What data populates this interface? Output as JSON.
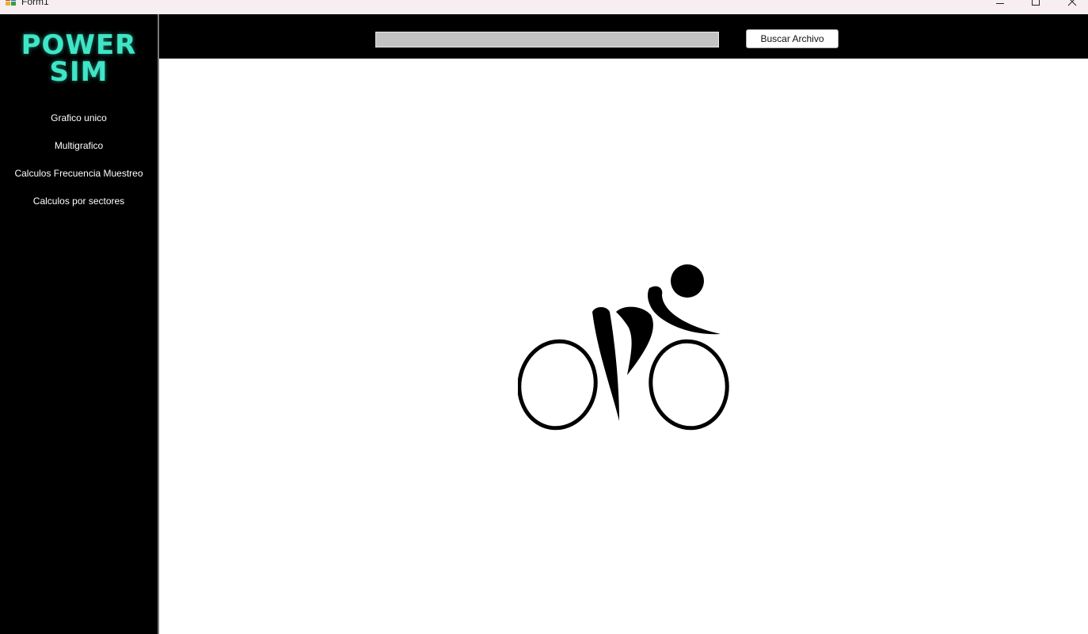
{
  "window": {
    "title": "Form1",
    "controls": {
      "minimize_icon": "minimize-icon",
      "maximize_icon": "maximize-icon",
      "close_icon": "close-icon"
    }
  },
  "sidebar": {
    "logo_line1": "POWER",
    "logo_line2": "SIM",
    "logo_color": "#3ee6c6",
    "items": [
      {
        "label": "Grafico unico"
      },
      {
        "label": "Multigrafico"
      },
      {
        "label": "Calculos Frecuencia Muestreo"
      },
      {
        "label": "Calculos por sectores"
      }
    ]
  },
  "toolbar": {
    "file_path_value": "",
    "browse_label": "Buscar Archivo"
  },
  "main": {
    "image_icon": "cyclist-icon"
  },
  "colors": {
    "sidebar_bg": "#000000",
    "topbar_bg": "#000000",
    "content_bg": "#ffffff",
    "input_bg": "#c3c3c3"
  }
}
